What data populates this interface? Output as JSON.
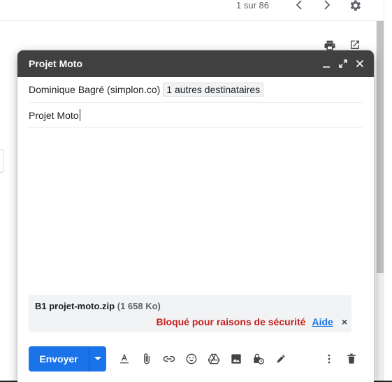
{
  "background": {
    "pager_text": "1 sur 86",
    "icons": [
      "chevron-left-icon",
      "chevron-right-icon",
      "gear-icon",
      "print-icon",
      "open-in-new-icon"
    ]
  },
  "compose": {
    "title": "Projet Moto",
    "header_icons": [
      "minimize-icon",
      "fullscreen-icon",
      "close-icon"
    ],
    "to": {
      "recipient": "Dominique Bagré (simplon.co)",
      "more_chip": "1 autres destinataires"
    },
    "subject": "Projet Moto",
    "attachment": {
      "name": "B1 projet-moto.zip",
      "size": "(1 658 Ko)",
      "warning": "Bloqué pour raisons de sécurité",
      "help": "Aide",
      "close": "×"
    },
    "toolbar": {
      "send_label": "Envoyer",
      "icons": [
        "format-text-icon",
        "attach-file-icon",
        "insert-link-icon",
        "emoji-icon",
        "drive-icon",
        "insert-photo-icon",
        "confidential-mode-icon",
        "signature-icon",
        "more-options-icon",
        "trash-icon"
      ]
    }
  },
  "colors": {
    "header_bg": "#404040",
    "send_blue": "#1a73e8",
    "warning_red": "#c5221f",
    "link_blue": "#1a73e8"
  }
}
